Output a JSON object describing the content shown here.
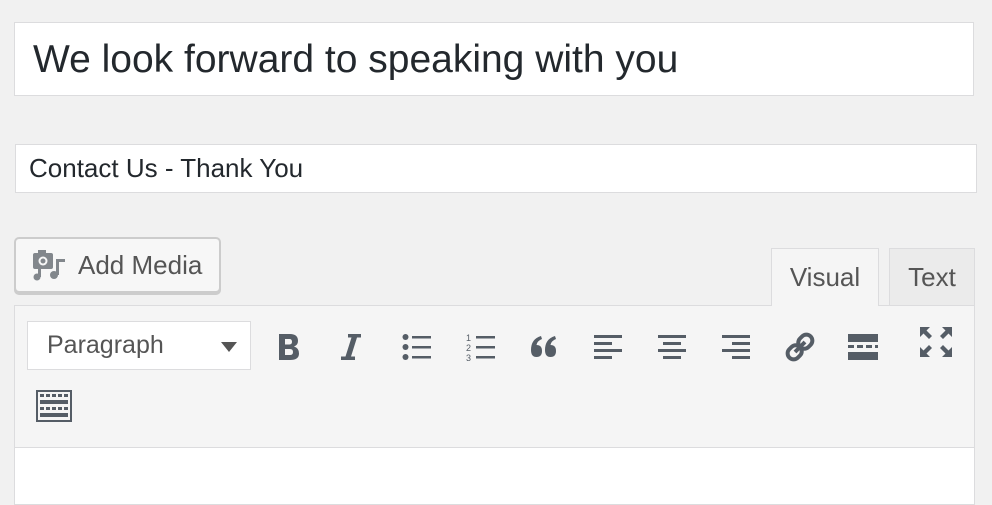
{
  "post": {
    "title_value": "We look forward to speaking with you",
    "subtitle_value": "Contact Us - Thank You"
  },
  "media": {
    "add_media_label": "Add Media",
    "icon": "add-media-icon"
  },
  "editor_tabs": {
    "visual_label": "Visual",
    "text_label": "Text",
    "active": "Visual"
  },
  "toolbar": {
    "format_selected": "Paragraph",
    "buttons": [
      "bold-icon",
      "italic-icon",
      "bulleted-list-icon",
      "numbered-list-icon",
      "blockquote-icon",
      "align-left-icon",
      "align-center-icon",
      "align-right-icon",
      "link-icon",
      "read-more-icon",
      "fullscreen-icon",
      "toolbar-toggle-icon"
    ]
  },
  "colors": {
    "background": "#f1f1f1",
    "icon": "#555d66",
    "border": "#dcdcde"
  }
}
